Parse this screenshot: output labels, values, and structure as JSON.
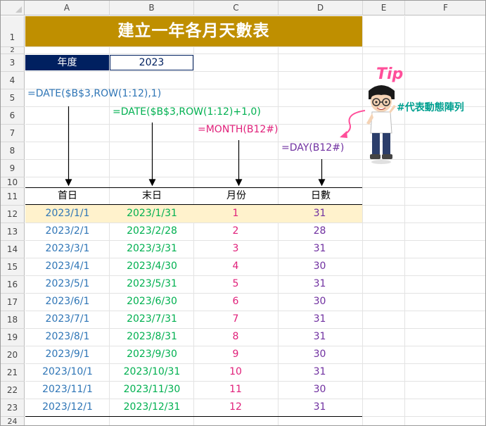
{
  "columns": [
    "A",
    "B",
    "C",
    "D",
    "E",
    "F"
  ],
  "rows": [
    "1",
    "2",
    "3",
    "4",
    "5",
    "6",
    "7",
    "8",
    "9",
    "10",
    "11",
    "12",
    "13",
    "14",
    "15",
    "16",
    "17",
    "18",
    "19",
    "20",
    "21",
    "22",
    "23",
    "24"
  ],
  "title": "建立一年各月天數表",
  "year": {
    "label": "年度",
    "value": "2023"
  },
  "formulas": {
    "first_day": "=DATE($B$3,ROW(1:12),1)",
    "last_day": "=DATE($B$3,ROW(1:12)+1,0)",
    "month": "=MONTH(B12#)",
    "days": "=DAY(B12#)"
  },
  "headers": {
    "first_day": "首日",
    "last_day": "末日",
    "month": "月份",
    "days": "日數"
  },
  "table": [
    {
      "first": "2023/1/1",
      "last": "2023/1/31",
      "month": "1",
      "days": "31"
    },
    {
      "first": "2023/2/1",
      "last": "2023/2/28",
      "month": "2",
      "days": "28"
    },
    {
      "first": "2023/3/1",
      "last": "2023/3/31",
      "month": "3",
      "days": "31"
    },
    {
      "first": "2023/4/1",
      "last": "2023/4/30",
      "month": "4",
      "days": "30"
    },
    {
      "first": "2023/5/1",
      "last": "2023/5/31",
      "month": "5",
      "days": "31"
    },
    {
      "first": "2023/6/1",
      "last": "2023/6/30",
      "month": "6",
      "days": "30"
    },
    {
      "first": "2023/7/1",
      "last": "2023/7/31",
      "month": "7",
      "days": "31"
    },
    {
      "first": "2023/8/1",
      "last": "2023/8/31",
      "month": "8",
      "days": "31"
    },
    {
      "first": "2023/9/1",
      "last": "2023/9/30",
      "month": "9",
      "days": "30"
    },
    {
      "first": "2023/10/1",
      "last": "2023/10/31",
      "month": "10",
      "days": "31"
    },
    {
      "first": "2023/11/1",
      "last": "2023/11/30",
      "month": "11",
      "days": "30"
    },
    {
      "first": "2023/12/1",
      "last": "2023/12/31",
      "month": "12",
      "days": "31"
    }
  ],
  "tip": {
    "label": "Tip",
    "note": "#代表動態陣列"
  },
  "colors": {
    "title_bg": "#bf8f00",
    "year_label_bg": "#002060",
    "highlight_row": "#fff2cc",
    "first_day": "#2e75b6",
    "last_day": "#00b050",
    "month": "#e0207a",
    "days": "#7030a0",
    "tip_note": "#00a090"
  }
}
